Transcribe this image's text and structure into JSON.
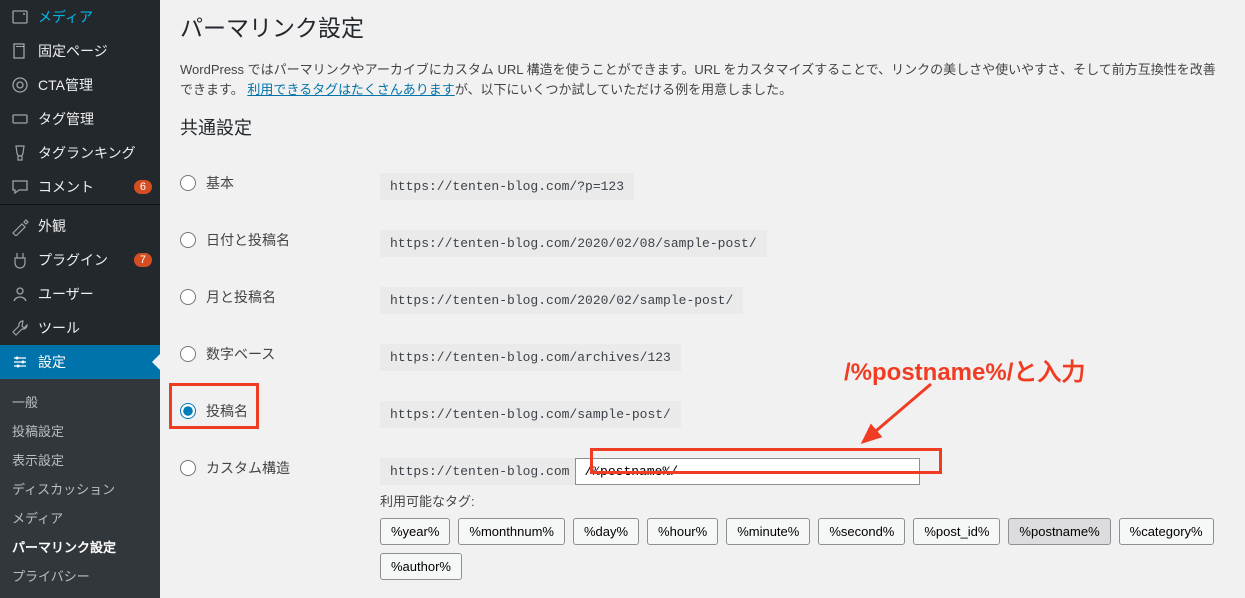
{
  "sidebar": {
    "items": [
      {
        "icon": "media-icon",
        "label": "メディア"
      },
      {
        "icon": "page-icon",
        "label": "固定ページ"
      },
      {
        "icon": "cta-icon",
        "label": "CTA管理"
      },
      {
        "icon": "tag-icon",
        "label": "タグ管理"
      },
      {
        "icon": "ranking-icon",
        "label": "タグランキング"
      },
      {
        "icon": "comment-icon",
        "label": "コメント",
        "badge": "6"
      },
      {
        "icon": "appearance-icon",
        "label": "外観"
      },
      {
        "icon": "plugin-icon",
        "label": "プラグイン",
        "badge": "7"
      },
      {
        "icon": "user-icon",
        "label": "ユーザー"
      },
      {
        "icon": "tool-icon",
        "label": "ツール"
      },
      {
        "icon": "settings-icon",
        "label": "設定",
        "current": true
      }
    ],
    "submenu": [
      {
        "label": "一般"
      },
      {
        "label": "投稿設定"
      },
      {
        "label": "表示設定"
      },
      {
        "label": "ディスカッション"
      },
      {
        "label": "メディア"
      },
      {
        "label": "パーマリンク設定",
        "current": true
      },
      {
        "label": "プライバシー"
      }
    ]
  },
  "page": {
    "title": "パーマリンク設定",
    "intro_before_link": "WordPress ではパーマリンクやアーカイブにカスタム URL 構造を使うことができます。URL をカスタマイズすることで、リンクの美しさや使いやすさ、そして前方互換性を改善できます。",
    "intro_link": "利用できるタグはたくさんあります",
    "intro_after_link": "が、以下にいくつか試していただける例を用意しました。",
    "section_heading": "共通設定",
    "options": [
      {
        "label": "基本",
        "example": "https://tenten-blog.com/?p=123"
      },
      {
        "label": "日付と投稿名",
        "example": "https://tenten-blog.com/2020/02/08/sample-post/"
      },
      {
        "label": "月と投稿名",
        "example": "https://tenten-blog.com/2020/02/sample-post/"
      },
      {
        "label": "数字ベース",
        "example": "https://tenten-blog.com/archives/123"
      },
      {
        "label": "投稿名",
        "example": "https://tenten-blog.com/sample-post/",
        "selected": true
      },
      {
        "label": "カスタム構造"
      }
    ],
    "custom": {
      "prefix": "https://tenten-blog.com",
      "value": "/%postname%/",
      "available_label": "利用可能なタグ:"
    },
    "tags": [
      "%year%",
      "%monthnum%",
      "%day%",
      "%hour%",
      "%minute%",
      "%second%",
      "%post_id%",
      "%postname%",
      "%category%",
      "%author%"
    ]
  },
  "annotation": {
    "text": "/%postname%/と入力"
  }
}
